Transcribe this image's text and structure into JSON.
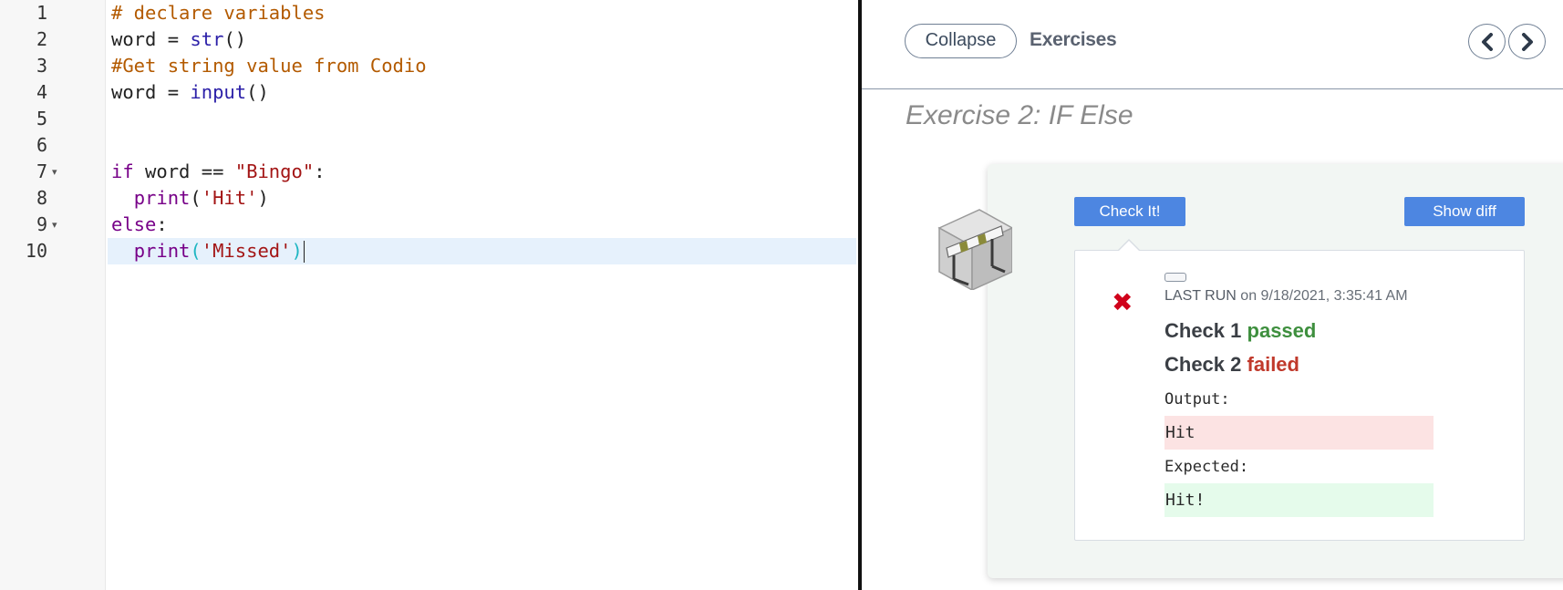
{
  "editor": {
    "line_numbers": [
      "1",
      "2",
      "3",
      "4",
      "5",
      "6",
      "7",
      "8",
      "9",
      "10"
    ],
    "fold_markers": [
      "▾",
      "▾"
    ],
    "lines": [
      {
        "comment": "# declare variables"
      },
      {
        "a": "word = ",
        "b": "str",
        "c": "()"
      },
      {
        "comment": "#Get string value from Codio"
      },
      {
        "a": "word = ",
        "b": "input",
        "c": "()"
      },
      {},
      {},
      {
        "kw": "if",
        "a": " word == ",
        "str": "\"Bingo\"",
        "c": ":"
      },
      {
        "indent": "  ",
        "b": "print",
        "c": "(",
        "str": "'Hit'",
        "d": ")"
      },
      {
        "kw": "else",
        "c": ":"
      },
      {
        "indent": "  ",
        "b": "print",
        "c": "(",
        "str": "'Missed'",
        "d": ")"
      }
    ]
  },
  "guide": {
    "collapse_label": "Collapse",
    "header_title": "Exercises",
    "prev_icon": "chevron-left-icon",
    "next_icon": "chevron-right-icon",
    "exercise_title": "Exercise 2: IF Else",
    "check_button": "Check It!",
    "diff_button": "Show diff",
    "result": {
      "last_run_label": "LAST RUN",
      "last_run_time": "on 9/18/2021, 3:35:41 AM",
      "check1_label": "Check 1",
      "check1_status": "passed",
      "check2_label": "Check 2",
      "check2_status": "failed",
      "output_label": "Output:",
      "output_value": "Hit",
      "expected_label": "Expected:",
      "expected_value": "Hit!"
    }
  },
  "colors": {
    "accent_button": "#4d86e1",
    "passed": "#3e8f3e",
    "failed": "#c0392b",
    "fail_icon": "#d0021b"
  }
}
